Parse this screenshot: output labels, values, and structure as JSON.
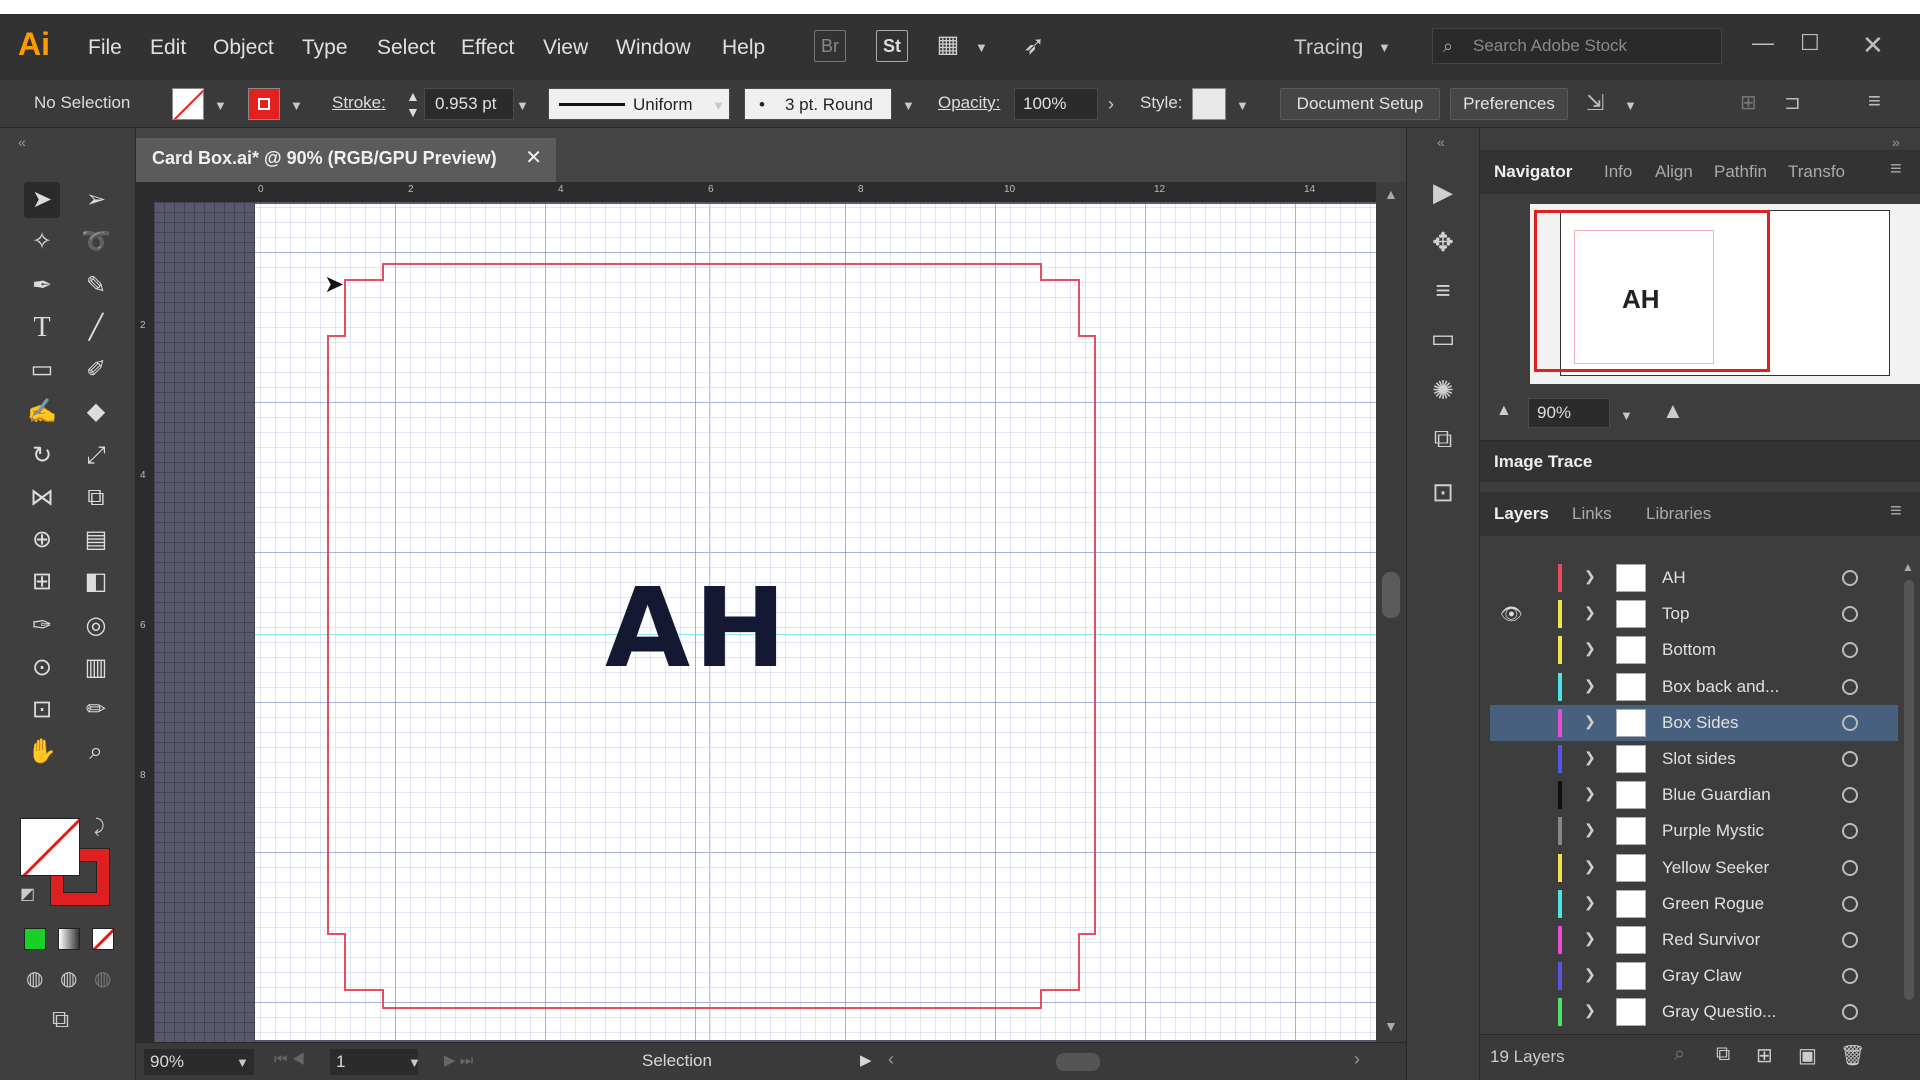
{
  "menubar": {
    "app_logo": "Ai",
    "items": [
      "File",
      "Edit",
      "Object",
      "Type",
      "Select",
      "Effect",
      "View",
      "Window",
      "Help"
    ],
    "bridge": "Br",
    "stock": "St",
    "workspace": "Tracing",
    "search_placeholder": "Search Adobe Stock"
  },
  "controlbar": {
    "selection": "No Selection",
    "stroke_label": "Stroke:",
    "stroke_value": "0.953 pt",
    "profile": "Uniform",
    "brush": "3 pt. Round",
    "opacity_label": "Opacity:",
    "opacity_value": "100%",
    "style_label": "Style:",
    "document_setup": "Document Setup",
    "preferences": "Preferences"
  },
  "document": {
    "tab_title": "Card Box.ai* @ 90% (RGB/GPU Preview)",
    "artboard_text": "AH",
    "ruler_top": [
      "0",
      "2",
      "4",
      "6",
      "8",
      "10",
      "12",
      "14"
    ],
    "ruler_left": [
      "2",
      "4",
      "6",
      "8"
    ]
  },
  "statusbar": {
    "zoom": "90%",
    "page": "1",
    "tool": "Selection"
  },
  "panels": {
    "nav_tabs": [
      "Navigator",
      "Info",
      "Align",
      "Pathfin",
      "Transfo"
    ],
    "nav_zoom": "90%",
    "nav_preview_text": "AH",
    "image_trace": "Image Trace",
    "layer_tabs": [
      "Layers",
      "Links",
      "Libraries"
    ],
    "layers": [
      {
        "name": "AH",
        "color": "#e84a5f"
      },
      {
        "name": "Top",
        "color": "#f2e24a"
      },
      {
        "name": "Bottom",
        "color": "#f2e24a"
      },
      {
        "name": "Box back and...",
        "color": "#4fe0e6"
      },
      {
        "name": "Box Sides",
        "color": "#e84ad8"
      },
      {
        "name": "Slot sides",
        "color": "#5555e6"
      },
      {
        "name": "Blue Guardian",
        "color": "#111111"
      },
      {
        "name": "Purple Mystic",
        "color": "#888888"
      },
      {
        "name": "Yellow Seeker",
        "color": "#f2e24a"
      },
      {
        "name": "Green Rogue",
        "color": "#4fe0e6"
      },
      {
        "name": "Red Survivor",
        "color": "#e84ad8"
      },
      {
        "name": "Gray Claw",
        "color": "#5555e6"
      },
      {
        "name": "Gray Questio...",
        "color": "#4ae06a"
      }
    ],
    "layer_count": "19 Layers"
  }
}
